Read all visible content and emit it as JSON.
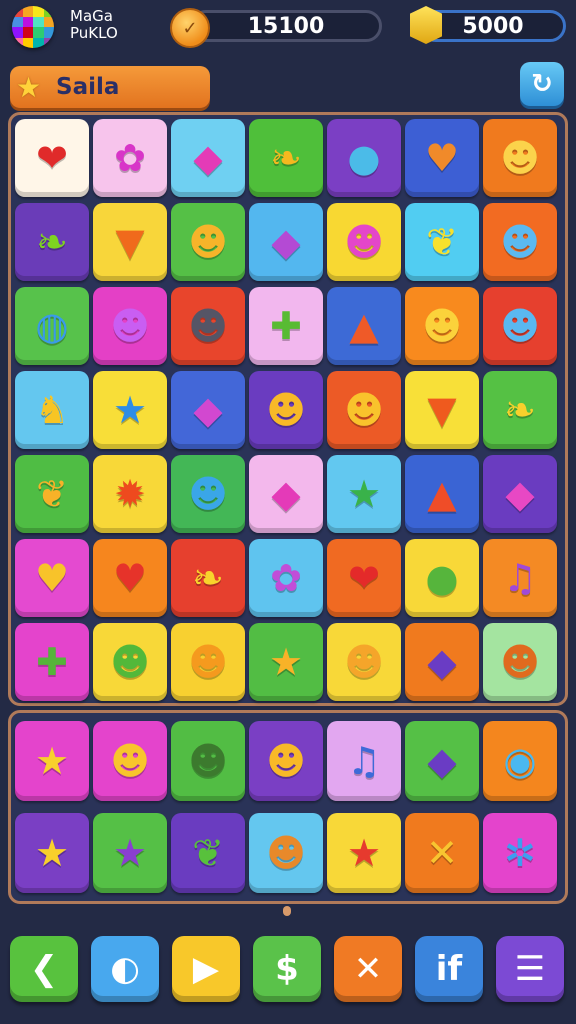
{
  "app": {
    "name_line1": "MaGa",
    "name_line2": "PuKLO",
    "logo_colors": [
      "#e8453c",
      "#f6a623",
      "#f8e71c",
      "#7ed321",
      "#4a90e2",
      "#bd10e0",
      "#50e3c2",
      "#f5a623",
      "#9013fe",
      "#d0021b",
      "#2ecc71",
      "#3498db",
      "#ff6b9d",
      "#ffcc00",
      "#00b5ad",
      "#8e44ad"
    ]
  },
  "resources": {
    "coins": "15100",
    "gems": "5000",
    "coin_icon": "coin-icon",
    "gem_icon": "gem-icon"
  },
  "level": {
    "title": "Saila",
    "star_icon": "star-icon",
    "refresh_icon": "refresh-icon"
  },
  "board": {
    "rows": [
      [
        {
          "icon": "heart",
          "glyph": "❤",
          "bg": "#fff6e8",
          "fg": "#e02a2a"
        },
        {
          "icon": "blob",
          "glyph": "✿",
          "bg": "#f7c4ec",
          "fg": "#d835c8"
        },
        {
          "icon": "candy",
          "glyph": "◆",
          "bg": "#6fd0f2",
          "fg": "#e43bb7"
        },
        {
          "icon": "leaf",
          "glyph": "❧",
          "bg": "#4fbf3a",
          "fg": "#f5b81f"
        },
        {
          "icon": "whale",
          "glyph": "●",
          "bg": "#7b3fc4",
          "fg": "#4bbbe8"
        },
        {
          "icon": "heart",
          "glyph": "♥",
          "bg": "#3d5fd4",
          "fg": "#f08a2a"
        },
        {
          "icon": "dog",
          "glyph": "☻",
          "bg": "#f07a1e",
          "fg": "#fbd34b"
        }
      ],
      [
        {
          "icon": "leaf",
          "glyph": "❧",
          "bg": "#6a3cb8",
          "fg": "#7ed321"
        },
        {
          "icon": "carrot",
          "glyph": "▼",
          "bg": "#f8d63a",
          "fg": "#f06a1c"
        },
        {
          "icon": "deer",
          "glyph": "☻",
          "bg": "#55c046",
          "fg": "#f6b42a"
        },
        {
          "icon": "rocket",
          "glyph": "◆",
          "bg": "#53b7ef",
          "fg": "#b44ad4"
        },
        {
          "icon": "smiley",
          "glyph": "☻",
          "bg": "#f8d832",
          "fg": "#e446c9"
        },
        {
          "icon": "leaf",
          "glyph": "❦",
          "bg": "#51cdf2",
          "fg": "#f8e12c"
        },
        {
          "icon": "drop",
          "glyph": "☻",
          "bg": "#f26b22",
          "fg": "#5bb9f0"
        }
      ],
      [
        {
          "icon": "planet",
          "glyph": "◍",
          "bg": "#57c24b",
          "fg": "#3a9be8"
        },
        {
          "icon": "monster",
          "glyph": "☻",
          "bg": "#e440c6",
          "fg": "#c95ef2"
        },
        {
          "icon": "mouse",
          "glyph": "☻",
          "bg": "#e8452c",
          "fg": "#555566"
        },
        {
          "icon": "turtle",
          "glyph": "✚",
          "bg": "#f2b7ee",
          "fg": "#58bb33"
        },
        {
          "icon": "rocket",
          "glyph": "▲",
          "bg": "#3d6ad6",
          "fg": "#ef5a28"
        },
        {
          "icon": "smiley",
          "glyph": "☻",
          "bg": "#f88a1e",
          "fg": "#fbd23b"
        },
        {
          "icon": "bear",
          "glyph": "☻",
          "bg": "#e6402e",
          "fg": "#5ab8f0"
        }
      ],
      [
        {
          "icon": "fox",
          "glyph": "♞",
          "bg": "#64c7ef",
          "fg": "#f8c524"
        },
        {
          "icon": "star",
          "glyph": "★",
          "bg": "#f8de38",
          "fg": "#2e8de6"
        },
        {
          "icon": "rocket",
          "glyph": "◆",
          "bg": "#4367d8",
          "fg": "#d248d0"
        },
        {
          "icon": "bear",
          "glyph": "☻",
          "bg": "#6a3cc0",
          "fg": "#f8b928"
        },
        {
          "icon": "bear",
          "glyph": "☻",
          "bg": "#ec5a26",
          "fg": "#f9c32c"
        },
        {
          "icon": "carrot",
          "glyph": "▼",
          "bg": "#f8e038",
          "fg": "#ef5a1e"
        },
        {
          "icon": "leaf",
          "glyph": "❧",
          "bg": "#55c144",
          "fg": "#f8d02c"
        }
      ],
      [
        {
          "icon": "leaf",
          "glyph": "❦",
          "bg": "#4fbd44",
          "fg": "#f8b228"
        },
        {
          "icon": "sun",
          "glyph": "✹",
          "bg": "#f8d838",
          "fg": "#ee4a1e"
        },
        {
          "icon": "smiley",
          "glyph": "☻",
          "bg": "#43b756",
          "fg": "#3aa6e8"
        },
        {
          "icon": "candy",
          "glyph": "◆",
          "bg": "#f3b8ec",
          "fg": "#e43ab8"
        },
        {
          "icon": "star",
          "glyph": "★",
          "bg": "#62c8f0",
          "fg": "#39b24a"
        },
        {
          "icon": "rocket",
          "glyph": "▲",
          "bg": "#3a64d4",
          "fg": "#ef4d28"
        },
        {
          "icon": "rocket",
          "glyph": "◆",
          "bg": "#6a3cc0",
          "fg": "#e848c4"
        }
      ],
      [
        {
          "icon": "heart",
          "glyph": "♥",
          "bg": "#e44ad0",
          "fg": "#f8c32a"
        },
        {
          "icon": "heart",
          "glyph": "♥",
          "bg": "#f6861e",
          "fg": "#e6332a"
        },
        {
          "icon": "leaf",
          "glyph": "❧",
          "bg": "#e6402e",
          "fg": "#f8d42c"
        },
        {
          "icon": "flower",
          "glyph": "✿",
          "bg": "#5fc4ef",
          "fg": "#c14ed8"
        },
        {
          "icon": "heart",
          "glyph": "❤",
          "bg": "#f06a22",
          "fg": "#e42a2a"
        },
        {
          "icon": "smiley",
          "glyph": "●",
          "bg": "#f8d838",
          "fg": "#56b53c"
        },
        {
          "icon": "music",
          "glyph": "♫",
          "bg": "#f48a24",
          "fg": "#a04ad8"
        }
      ],
      [
        {
          "icon": "turtle",
          "glyph": "✚",
          "bg": "#e444cc",
          "fg": "#56b43a"
        },
        {
          "icon": "frog",
          "glyph": "☻",
          "bg": "#f8d838",
          "fg": "#52b83a"
        },
        {
          "icon": "sun",
          "glyph": "☻",
          "bg": "#f8d030",
          "fg": "#f59a1e"
        },
        {
          "icon": "star",
          "glyph": "★",
          "bg": "#52bd44",
          "fg": "#f8b228"
        },
        {
          "icon": "smiley",
          "glyph": "☻",
          "bg": "#f8d838",
          "fg": "#f5a52a"
        },
        {
          "icon": "rocket",
          "glyph": "◆",
          "bg": "#f07a1e",
          "fg": "#6a3cc4"
        },
        {
          "icon": "bear",
          "glyph": "☻",
          "bg": "#a4e4a0",
          "fg": "#e06a1e"
        }
      ]
    ]
  },
  "tray": {
    "rows": [
      [
        {
          "icon": "star",
          "glyph": "★",
          "bg": "#e444cc",
          "fg": "#f8d02c"
        },
        {
          "icon": "bear",
          "glyph": "☻",
          "bg": "#e444cc",
          "fg": "#f8c52c"
        },
        {
          "icon": "bear",
          "glyph": "☻",
          "bg": "#52bd44",
          "fg": "#3c7a2e"
        },
        {
          "icon": "bear",
          "glyph": "☻",
          "bg": "#7a3fc4",
          "fg": "#f8b928"
        },
        {
          "icon": "music",
          "glyph": "♫",
          "bg": "#e2a7f0",
          "fg": "#3e6ad8"
        },
        {
          "icon": "rocket",
          "glyph": "◆",
          "bg": "#55c046",
          "fg": "#6a3cc4"
        },
        {
          "icon": "ring",
          "glyph": "◉",
          "bg": "#f4861e",
          "fg": "#4ab8f0"
        }
      ],
      [
        {
          "icon": "star",
          "glyph": "★",
          "bg": "#7a3fc4",
          "fg": "#f8d02c"
        },
        {
          "icon": "star",
          "glyph": "★",
          "bg": "#55c046",
          "fg": "#8a3fd0"
        },
        {
          "icon": "leaf",
          "glyph": "❦",
          "bg": "#6a3cc0",
          "fg": "#58c13c"
        },
        {
          "icon": "deer",
          "glyph": "☻",
          "bg": "#64c7ef",
          "fg": "#e8892a"
        },
        {
          "icon": "star",
          "glyph": "★",
          "bg": "#f8d838",
          "fg": "#e63a2e"
        },
        {
          "icon": "bone",
          "glyph": "✕",
          "bg": "#f07a1e",
          "fg": "#f8c530"
        },
        {
          "icon": "gear",
          "glyph": "✲",
          "bg": "#e444cc",
          "fg": "#3e9ef0"
        }
      ]
    ]
  },
  "toolbar": {
    "buttons": [
      {
        "name": "back-button",
        "icon": "chevron-left-icon",
        "glyph": "❮",
        "bg": "#58c23e"
      },
      {
        "name": "shape-button",
        "icon": "shape-icon",
        "glyph": "◐",
        "bg": "#48a8ee"
      },
      {
        "name": "play-button",
        "icon": "play-icon",
        "glyph": "▶",
        "bg": "#f8c82a"
      },
      {
        "name": "cash-button",
        "icon": "dollar-icon",
        "glyph": "$",
        "bg": "#5ac24a"
      },
      {
        "name": "close-button",
        "icon": "close-icon",
        "glyph": "✕",
        "bg": "#f07a24"
      },
      {
        "name": "info-button",
        "icon": "info-icon",
        "glyph": "if",
        "bg": "#3a84dc"
      },
      {
        "name": "menu-button",
        "icon": "menu-icon",
        "glyph": "☰",
        "bg": "#7c4ad4"
      }
    ]
  }
}
